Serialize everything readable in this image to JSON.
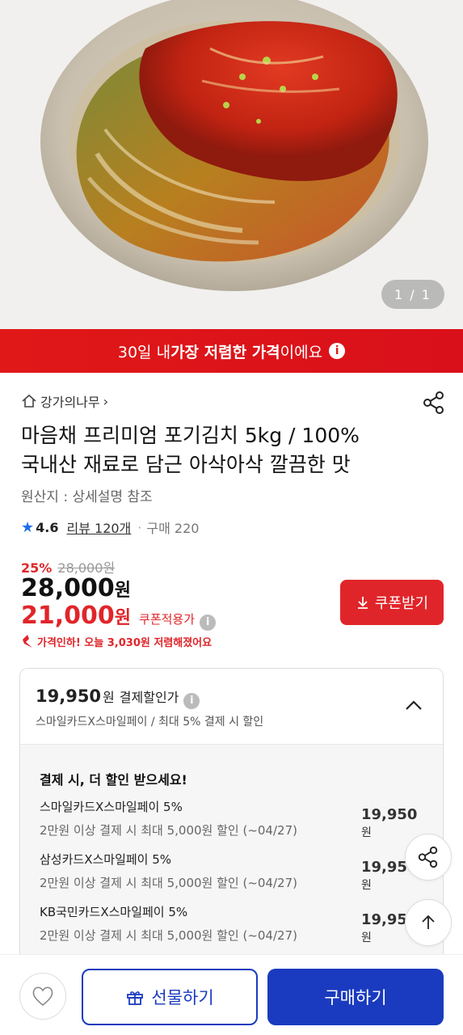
{
  "hero": {
    "image_alt": "kimchi",
    "counter": "1 / 1"
  },
  "banner": {
    "pre": "30일 내 ",
    "bold": "가장 저렴한 가격",
    "post": "이에요",
    "info_glyph": "i"
  },
  "store": {
    "name": "강가의나무",
    "chevron": "›"
  },
  "product": {
    "title_line1": "마음채 프리미엄 포기김치 5kg / 100%",
    "title_line2": "국내산 재료로 담근 아삭아삭 깔끔한 맛",
    "origin": "원산지 : 상세설명 참조"
  },
  "rating": {
    "star": "★",
    "score": "4.6",
    "review": "리뷰 120개",
    "dot": "·",
    "purchases": "구매 220"
  },
  "price": {
    "discount_pct": "25%",
    "original": "28,000원",
    "sale": "28,000",
    "sale_unit": "원",
    "coupon_price": "21,000",
    "coupon_unit": "원",
    "coupon_label": "쿠폰적용가",
    "info_glyph": "i",
    "drop_text": "가격인하! 오늘 3,030원 저렴해졌어요"
  },
  "coupon_button": {
    "icon": "download-icon",
    "label": "쿠폰받기"
  },
  "payment": {
    "price": "19,950",
    "unit": "원",
    "label": "결제할인가",
    "info_glyph": "i",
    "subtitle": "스마일카드X스마일페이 / 최대 5% 결제 시 할인",
    "body_title": "결제 시, 더 할인 받으세요!",
    "cards": [
      {
        "name": "스마일카드X스마일페이 5%",
        "desc": "2만원 이상 결제 시 최대 5,000원 할인 (~04/27)",
        "amount": "19,950",
        "unit": "원"
      },
      {
        "name": "삼성카드X스마일페이 5%",
        "desc": "2만원 이상 결제 시 최대 5,000원 할인 (~04/27)",
        "amount": "19,950",
        "unit": "원"
      },
      {
        "name": "KB국민카드X스마일페이 5%",
        "desc": "2만원 이상 결제 시 최대 5,000원 할인 (~04/27)",
        "amount": "19,950",
        "unit": "원"
      }
    ]
  },
  "bottom_bar": {
    "gift_label": "선물하기",
    "buy_label": "구매하기"
  },
  "colors": {
    "accent_red": "#e0252a",
    "brand_blue": "#1a3bbf",
    "rating_blue": "#1a6ee8"
  }
}
